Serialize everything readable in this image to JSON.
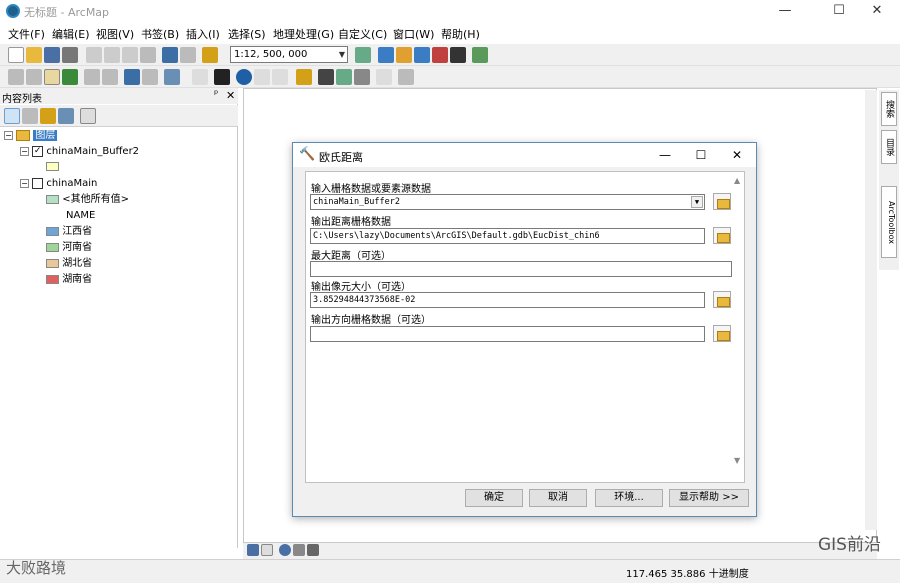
{
  "window": {
    "title": "无标题 - ArcMap",
    "minimize": "—",
    "maximize": "☐",
    "close": "✕"
  },
  "menu": [
    "文件(F)",
    "编辑(E)",
    "视图(V)",
    "书签(B)",
    "插入(I)",
    "选择(S)",
    "地理处理(G)",
    "自定义(C)",
    "窗口(W)",
    "帮助(H)"
  ],
  "toolbar": {
    "scale": "1:12, 500, 000"
  },
  "toc": {
    "title": "内容列表",
    "pin": "ᵖ",
    "close": "✕",
    "root": "图层",
    "layers": [
      {
        "name": "chinaMain_Buffer2",
        "checked": true
      },
      {
        "name": "chinaMain",
        "checked": false
      }
    ],
    "legend": {
      "other": "<其他所有值>",
      "field": "NAME",
      "items": [
        {
          "label": "江西省",
          "color": "#6fa5d6"
        },
        {
          "label": "河南省",
          "color": "#9fd59a"
        },
        {
          "label": "湖北省",
          "color": "#e8c79a"
        },
        {
          "label": "湖南省",
          "color": "#e06060"
        }
      ],
      "other_color": "#b5e0c4",
      "buffer_color": "#ffffc0"
    }
  },
  "side_tabs": [
    "搜索",
    "目录",
    "ArcToolbox"
  ],
  "dialog": {
    "title": "欧氏距离",
    "fields": [
      {
        "label": "输入栅格数据或要素源数据",
        "value": "chinaMain_Buffer2",
        "dropdown": true,
        "folder": true
      },
      {
        "label": "输出距离栅格数据",
        "value": "C:\\Users\\lazy\\Documents\\ArcGIS\\Default.gdb\\EucDist_chin6",
        "dropdown": false,
        "folder": true
      },
      {
        "label": "最大距离（可选）",
        "value": "",
        "dropdown": false,
        "folder": false
      },
      {
        "label": "输出像元大小（可选）",
        "value": "3.85294844373568E-02",
        "dropdown": false,
        "folder": true
      },
      {
        "label": "输出方向栅格数据（可选）",
        "value": "",
        "dropdown": false,
        "folder": true
      }
    ],
    "buttons": {
      "ok": "确定",
      "cancel": "取消",
      "env": "环境...",
      "help": "显示帮助 >>"
    }
  },
  "status": {
    "coords": "117.465  35.886 十进制度"
  },
  "watermark": {
    "right": "GIS前沿",
    "left": "大败路境"
  }
}
